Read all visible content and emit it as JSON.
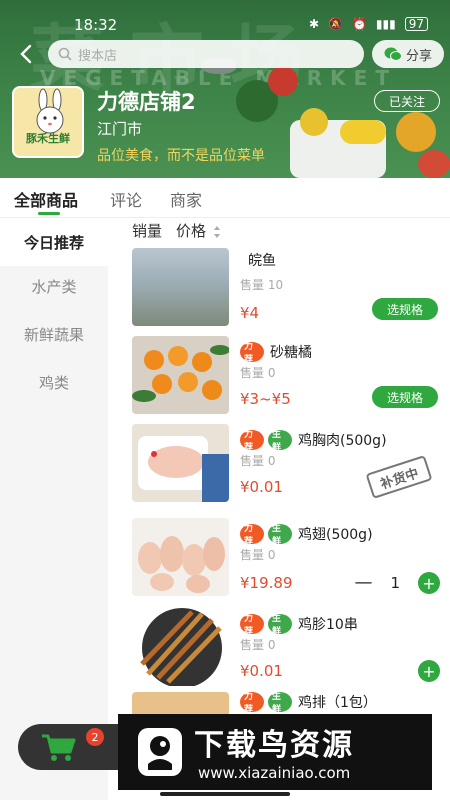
{
  "status": {
    "time": "18:32",
    "battery": "97"
  },
  "header": {
    "banner_text": "菜市场",
    "banner_subtext": "VEGETABLE MARKET",
    "search_placeholder": "搜本店",
    "share_label": "分享"
  },
  "store": {
    "logo_text": "豚禾生鲜",
    "name": "力德店铺2",
    "city": "江门市",
    "slogan": "品位美食，而不是品位菜单",
    "follow_label": "已关注"
  },
  "tabs": [
    {
      "label": "全部商品"
    },
    {
      "label": "评论"
    },
    {
      "label": "商家"
    }
  ],
  "categories": [
    {
      "label": "今日推荐"
    },
    {
      "label": "水产类"
    },
    {
      "label": "新鲜蔬果"
    },
    {
      "label": "鸡类"
    }
  ],
  "sort": {
    "sales_label": "销量",
    "price_label": "价格"
  },
  "tags": {
    "recommend": "力荐",
    "fresh": "生鲜"
  },
  "products": [
    {
      "name": "皖鱼",
      "sales": "售量 10",
      "price": "¥4",
      "action": "选规格"
    },
    {
      "name": "砂糖橘",
      "sales": "售量 0",
      "price": "¥3~¥5",
      "action": "选规格"
    },
    {
      "name": "鸡胸肉(500g)",
      "sales": "售量 0",
      "price": "¥0.01",
      "stamp": "补货中"
    },
    {
      "name": "鸡翅(500g)",
      "sales": "售量 0",
      "price": "¥19.89",
      "qty": "1"
    },
    {
      "name": "鸡胗10串",
      "sales": "售量 0",
      "price": "¥0.01"
    },
    {
      "name": "鸡排（1包）"
    }
  ],
  "cart": {
    "count": "2",
    "currency": "¥"
  },
  "watermark": {
    "title": "下载鸟资源",
    "url": "www.xiazainiao.com"
  },
  "colors": {
    "accent": "#2ea83f",
    "price": "#e24b2c",
    "banner": "#3c8247"
  }
}
